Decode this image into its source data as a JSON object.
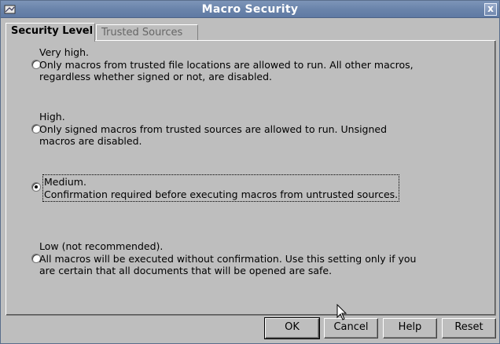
{
  "window": {
    "title": "Macro Security",
    "close_symbol": "x"
  },
  "tabs": [
    {
      "label": "Security Level",
      "active": true
    },
    {
      "label": "Trusted Sources",
      "active": false
    }
  ],
  "options": [
    {
      "title": "Very high.",
      "lines": [
        "Only macros from trusted file locations are allowed to run. All other macros,",
        "regardless whether signed or not, are disabled."
      ],
      "selected": false
    },
    {
      "title": "High.",
      "lines": [
        "Only signed macros from trusted sources are allowed to run. Unsigned",
        "macros are disabled."
      ],
      "selected": false
    },
    {
      "title": "Medium.",
      "lines": [
        "Confirmation required before executing macros from untrusted sources."
      ],
      "selected": true
    },
    {
      "title": "Low (not recommended).",
      "lines": [
        "All macros will be executed without confirmation. Use this setting only if you",
        "are certain that all documents that will be opened are safe."
      ],
      "selected": false
    }
  ],
  "buttons": {
    "ok": "OK",
    "cancel": "Cancel",
    "help": "Help",
    "reset": "Reset"
  },
  "icons": {
    "app": "document-icon",
    "close": "close-icon",
    "cursor": "mouse-pointer-icon"
  }
}
